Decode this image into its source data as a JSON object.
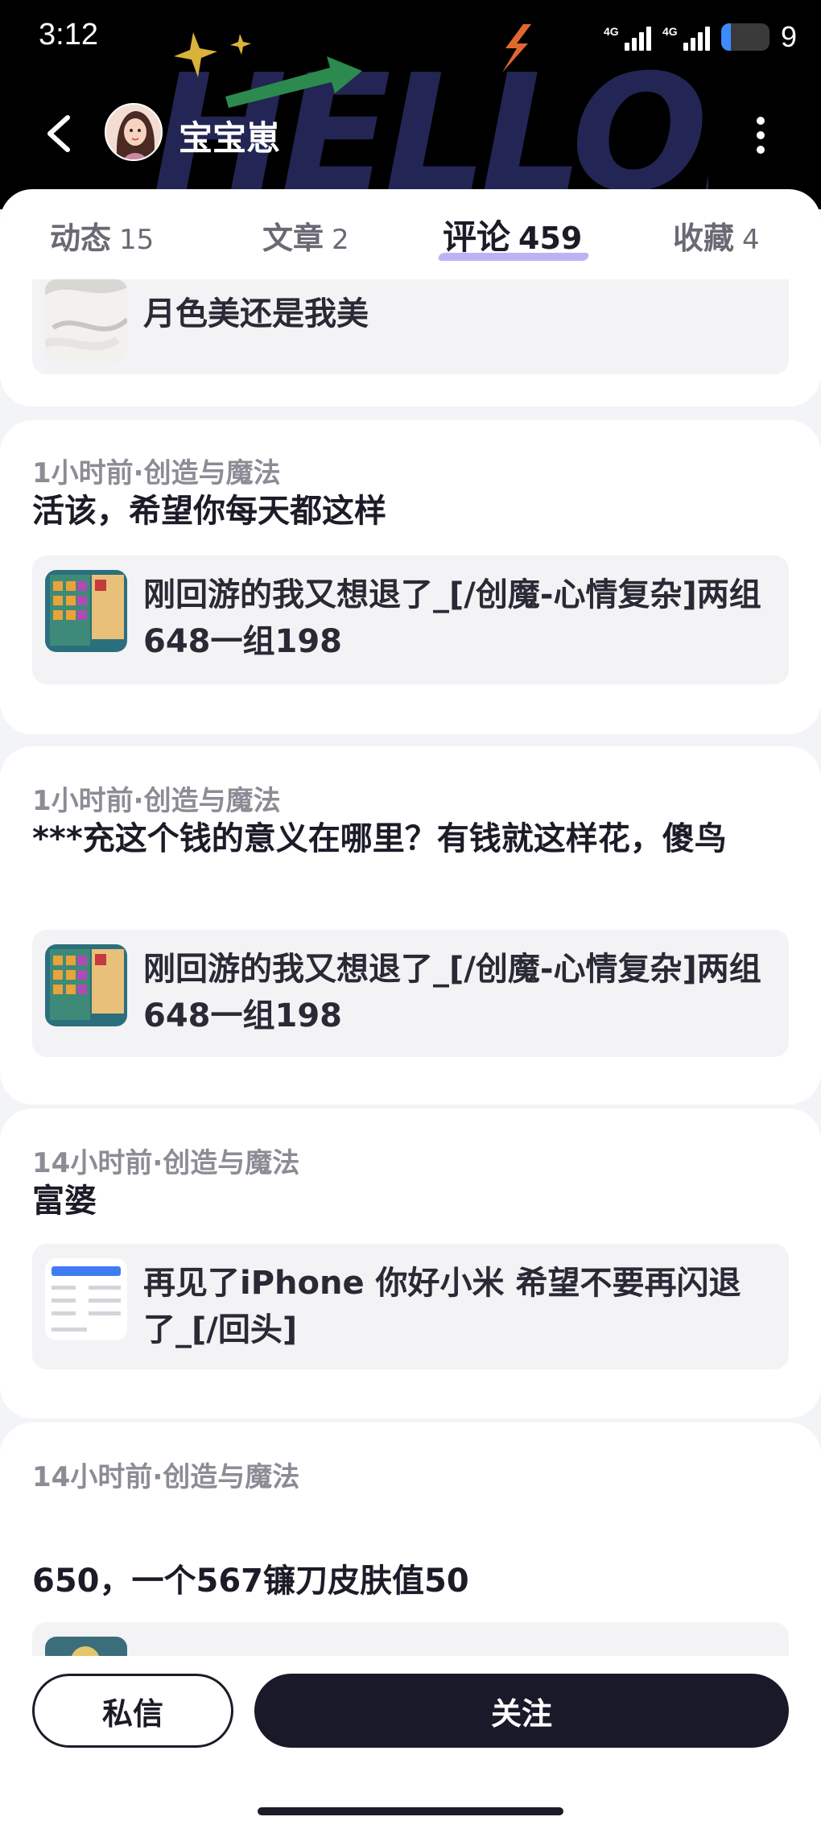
{
  "status_bar": {
    "time": "3:12",
    "signal_1_label": "4G",
    "signal_2_label": "4G",
    "battery_level": "9"
  },
  "header": {
    "username": "宝宝崽",
    "background_art_text": "HELLO."
  },
  "tabs": [
    {
      "label": "动态",
      "count": "15"
    },
    {
      "label": "文章",
      "count": "2"
    },
    {
      "label": "评论",
      "count": "459",
      "active": true
    },
    {
      "label": "收藏",
      "count": "4"
    }
  ],
  "cards": [
    {
      "quote": {
        "thumb": "white-fabric-photo",
        "text": "月色美还是我美"
      }
    },
    {
      "meta": "1小时前·创造与魔法",
      "text": "活该，希望你每天都这样",
      "quote": {
        "thumb": "game-inventory-screenshot",
        "text": "刚回游的我又想退了_[/创魔-心情复杂]两组648一组198"
      }
    },
    {
      "meta": "1小时前·创造与魔法",
      "text": "***充这个钱的意义在哪里？有钱就这样花，傻鸟",
      "quote": {
        "thumb": "game-inventory-screenshot",
        "text": "刚回游的我又想退了_[/创魔-心情复杂]两组648一组198"
      }
    },
    {
      "meta": "14小时前·创造与魔法",
      "text": "富婆",
      "quote": {
        "thumb": "phone-settings-screenshot",
        "text": "再见了iPhone 你好小米 希望不要再闪退了_[/回头]"
      }
    },
    {
      "meta": "14小时前·创造与魔法",
      "text": "650，一个567镰刀皮肤值50",
      "quote": {
        "thumb": "game-scene-screenshot",
        "text": ""
      }
    }
  ],
  "bottom_bar": {
    "message_label": "私信",
    "follow_label": "关注"
  },
  "colors": {
    "header_bg": "#000000",
    "page_bg": "#f3f4f7",
    "card_bg": "#ffffff",
    "quote_bg": "#f3f3f5",
    "tab_accent": "#b9a8f4",
    "follow_button": "#191929",
    "meta_text": "#8c8c96"
  }
}
